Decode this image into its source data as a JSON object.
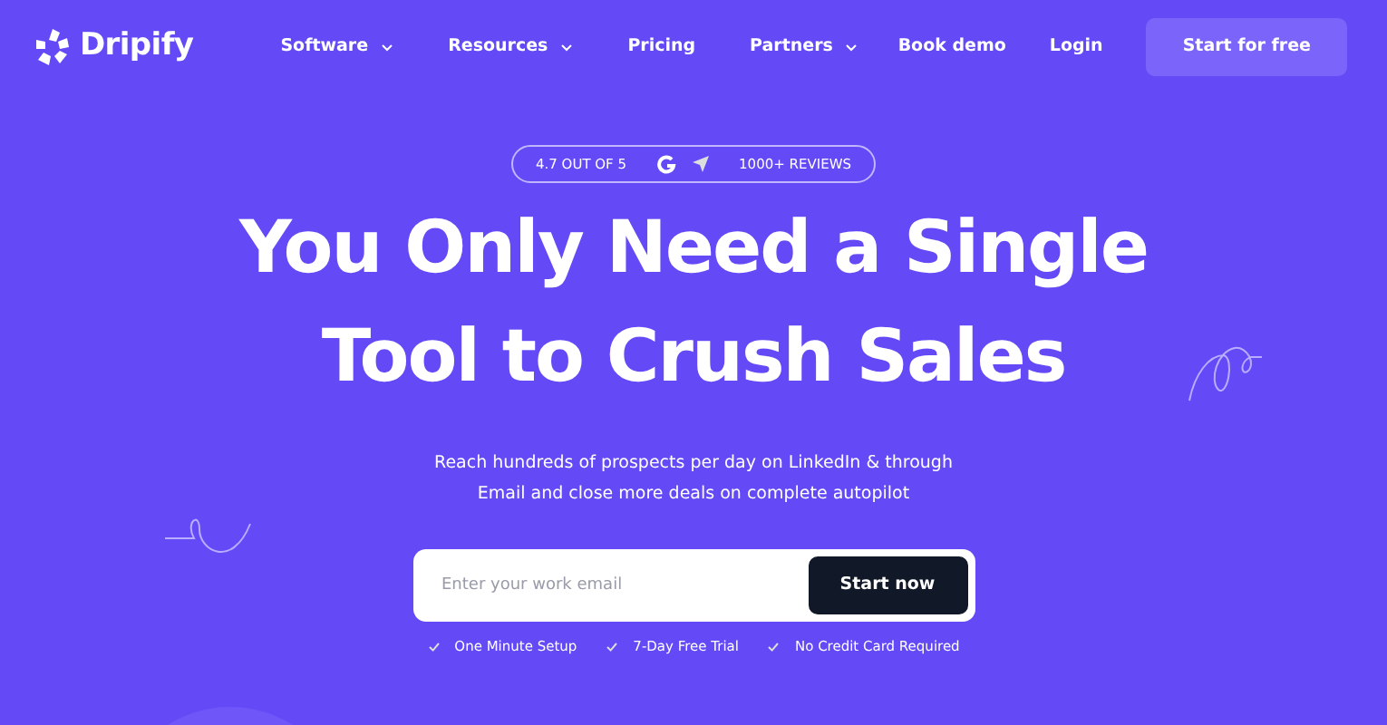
{
  "brand": {
    "name": "Dripify"
  },
  "nav": [
    {
      "label": "Software",
      "has_menu": true
    },
    {
      "label": "Resources",
      "has_menu": true
    },
    {
      "label": "Pricing",
      "has_menu": false
    },
    {
      "label": "Partners",
      "has_menu": true
    }
  ],
  "actions": {
    "book_demo": "Book demo",
    "login": "Login",
    "start": "Start for free"
  },
  "rating": {
    "score": "4.7 OUT OF 5",
    "reviews": "1000+ REVIEWS"
  },
  "headline": [
    "You Only Need a Single",
    "Tool to Crush Sales"
  ],
  "subtitle": [
    "Reach hundreds of prospects per day on LinkedIn & through",
    "Email and close more deals on complete autopilot"
  ],
  "signup": {
    "placeholder": "Enter your work email",
    "button": "Start now"
  },
  "perks": [
    "One Minute Setup",
    "7-Day Free Trial",
    "No Credit Card Required"
  ]
}
